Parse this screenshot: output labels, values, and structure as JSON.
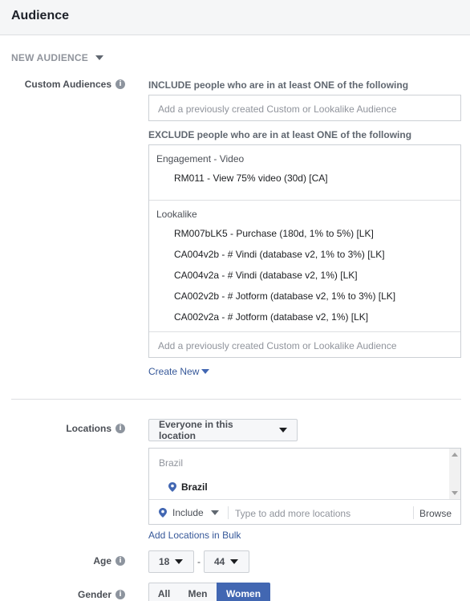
{
  "header": {
    "title": "Audience"
  },
  "new_audience": {
    "label": "NEW AUDIENCE"
  },
  "custom_audiences": {
    "label": "Custom Audiences",
    "include_caption": "INCLUDE people who are in at least ONE of the following",
    "include_placeholder": "Add a previously created Custom or Lookalike Audience",
    "exclude_caption": "EXCLUDE people who are in at least ONE of the following",
    "groups": [
      {
        "title": "Engagement - Video",
        "items": [
          "RM011 - View 75% video (30d) [CA]"
        ]
      },
      {
        "title": "Lookalike",
        "items": [
          "RM007bLK5 - Purchase (180d, 1% to 5%) [LK]",
          "CA004v2b - # Vindi (database v2, 1% to 3%) [LK]",
          "CA004v2a - # Vindi (database v2, 1%) [LK]",
          "CA002v2b - # Jotform (database v2, 1% to 3%) [LK]",
          "CA002v2a - # Jotform (database v2, 1%) [LK]"
        ]
      }
    ],
    "exclude_placeholder": "Add a previously created Custom or Lookalike Audience",
    "create_new": "Create New"
  },
  "locations": {
    "label": "Locations",
    "dropdown": "Everyone in this location",
    "group_title": "Brazil",
    "selected": "Brazil",
    "include_label": "Include",
    "input_placeholder": "Type to add more locations",
    "browse": "Browse",
    "bulk_link": "Add Locations in Bulk"
  },
  "age": {
    "label": "Age",
    "min": "18",
    "separator": "-",
    "max": "44"
  },
  "gender": {
    "label": "Gender",
    "options": [
      "All",
      "Men",
      "Women"
    ],
    "selected": "Women"
  },
  "colors": {
    "accent": "#4267b2",
    "link": "#365899"
  }
}
